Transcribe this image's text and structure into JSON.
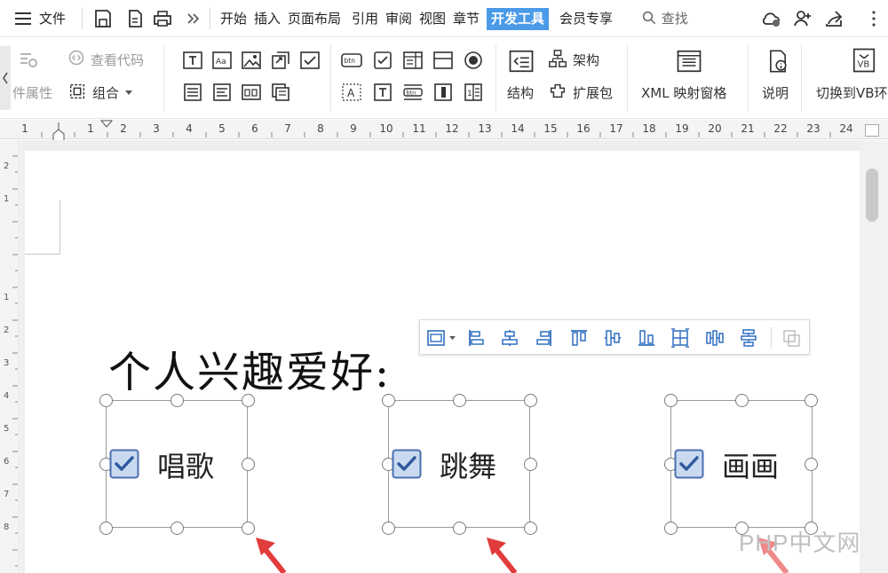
{
  "menubar": {
    "file_label": "文件",
    "tabs": [
      "开始",
      "插入",
      "页面布局",
      "引用",
      "审阅",
      "视图",
      "章节",
      "开发工具",
      "会员专享"
    ],
    "search_label": "查找"
  },
  "ribbon": {
    "properties_label": "件属性",
    "view_code_label": "查看代码",
    "group_label": "组合",
    "structure_label": "结构",
    "schema_label": "架构",
    "expansion_pack_label": "扩展包",
    "xml_mapping_label": "XML 映射窗格",
    "description_label": "说明",
    "switch_vb_label": "切换到VB环"
  },
  "ruler": {
    "ticks": [
      "1",
      "1",
      "2",
      "3",
      "4",
      "5",
      "6",
      "7",
      "8",
      "9",
      "10",
      "11",
      "12",
      "13",
      "14",
      "15",
      "16",
      "17",
      "18",
      "19",
      "20",
      "21",
      "22",
      "23",
      "24"
    ]
  },
  "document": {
    "heading": "个人兴趣爱好:",
    "checkboxes": [
      {
        "label": "唱歌",
        "checked": true
      },
      {
        "label": "跳舞",
        "checked": true
      },
      {
        "label": "画画",
        "checked": true
      }
    ]
  },
  "watermark": "PHP中文网",
  "colors": {
    "active_tab": "#4a9ae8",
    "checkbox_fill": "#c9d9f0",
    "checkbox_border": "#4a6fb0",
    "arrow_red": "#e23b3b"
  }
}
